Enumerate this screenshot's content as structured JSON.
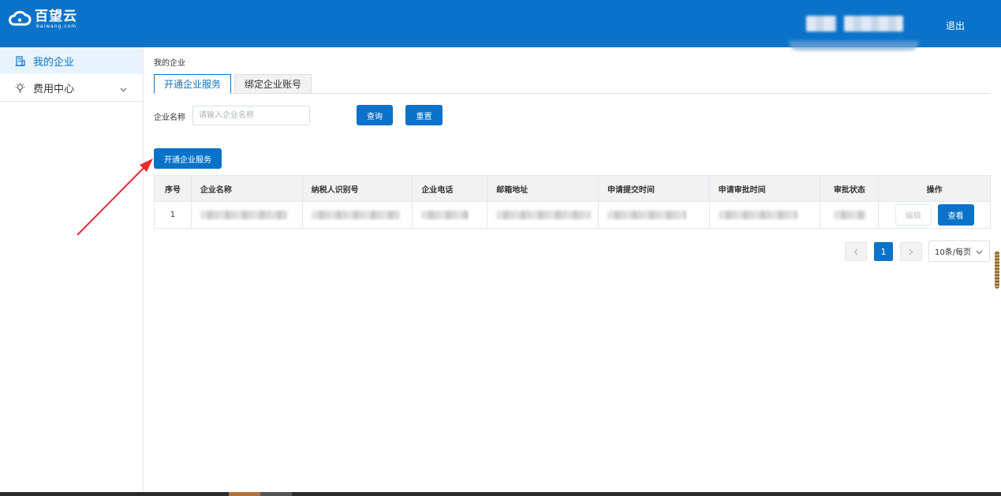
{
  "header": {
    "logo_main": "百望云",
    "logo_sub": "baiwang.com",
    "logout_label": "退出",
    "accent_color": "#0a73c9"
  },
  "sidebar": {
    "items": [
      {
        "label": "我的企业",
        "icon": "building-icon",
        "active": true
      },
      {
        "label": "费用中心",
        "icon": "lightbulb-icon",
        "expandable": true
      }
    ]
  },
  "main": {
    "breadcrumb": "我的企业",
    "tabs": [
      {
        "label": "开通企业服务",
        "active": true
      },
      {
        "label": "绑定企业账号",
        "active": false
      }
    ],
    "filter": {
      "label": "企业名称",
      "placeholder": "请输入企业名称",
      "query_label": "查询",
      "reset_label": "重置"
    },
    "open_service_label": "开通企业服务",
    "table": {
      "columns": [
        "序号",
        "企业名称",
        "纳税人识别号",
        "企业电话",
        "邮箱地址",
        "申请提交时间",
        "申请审批时间",
        "审批状态",
        "操作"
      ],
      "rows": [
        {
          "index": "1",
          "edit_label": "编辑",
          "view_label": "查看"
        }
      ]
    },
    "pagination": {
      "current_page": "1",
      "page_size_label": "10条/每页"
    }
  }
}
